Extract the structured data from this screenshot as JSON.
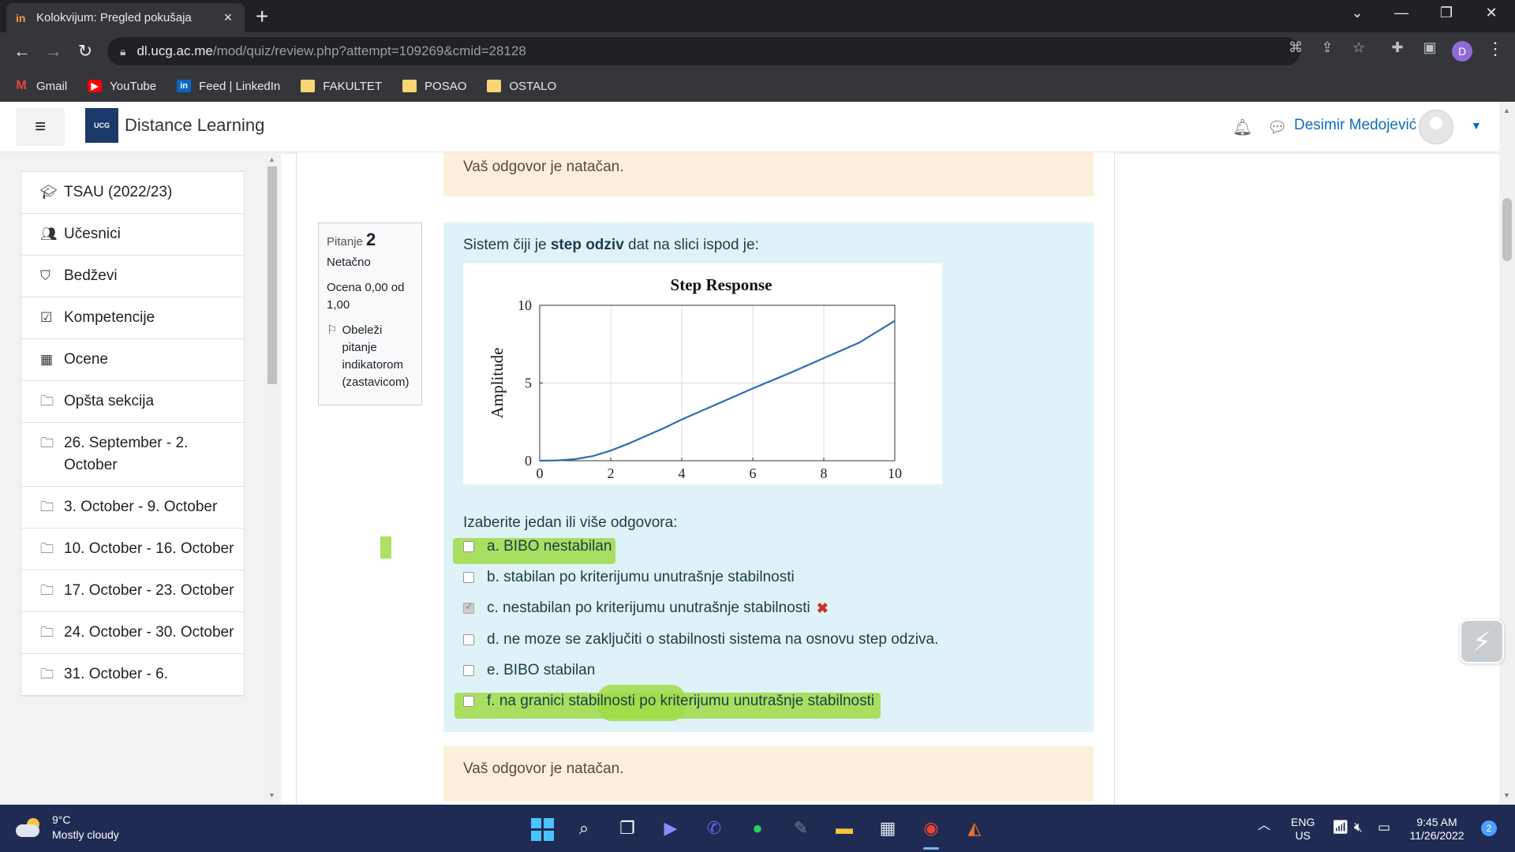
{
  "browser": {
    "tab_title": "Kolokvijum: Pregled pokušaja",
    "favicon": "in",
    "url_host": "dl.ucg.ac.me",
    "url_path": "/mod/quiz/review.php?attempt=109269&cmid=28128",
    "profile_initial": "D",
    "bookmarks": [
      {
        "label": "Gmail",
        "icon": "gmail-icon"
      },
      {
        "label": "YouTube",
        "icon": "youtube-icon"
      },
      {
        "label": "Feed | LinkedIn",
        "icon": "linkedin-icon"
      },
      {
        "label": "FAKULTET",
        "icon": "folder-icon"
      },
      {
        "label": "POSAO",
        "icon": "folder-icon"
      },
      {
        "label": "OSTALO",
        "icon": "folder-icon"
      }
    ]
  },
  "header": {
    "logo_text": "UCG",
    "site_name": "Distance Learning",
    "user_name": "Desimir Medojević"
  },
  "sidebar": {
    "items": [
      {
        "label": "TSAU (2022/23)",
        "icon": "graduation-cap-icon"
      },
      {
        "label": "Učesnici",
        "icon": "users-icon"
      },
      {
        "label": "Bedževi",
        "icon": "shield-icon"
      },
      {
        "label": "Kompetencije",
        "icon": "checkbox-icon"
      },
      {
        "label": "Ocene",
        "icon": "table-icon"
      },
      {
        "label": "Opšta sekcija",
        "icon": "folder-icon"
      },
      {
        "label": "26. September - 2. October",
        "icon": "folder-icon"
      },
      {
        "label": "3. October - 9. October",
        "icon": "folder-icon"
      },
      {
        "label": "10. October - 16. October",
        "icon": "folder-icon"
      },
      {
        "label": "17. October - 23. October",
        "icon": "folder-icon"
      },
      {
        "label": "24. October - 30. October",
        "icon": "folder-icon"
      },
      {
        "label": "31. October - 6.",
        "icon": "folder-icon"
      }
    ]
  },
  "quiz": {
    "feedback_top": "Vaš odgovor je natačan.",
    "feedback_bottom": "Vaš odgovor je natačan.",
    "info": {
      "question_label": "Pitanje",
      "question_number": "2",
      "state": "Netačno",
      "grade": "Ocena 0,00 od 1,00",
      "flag_label": "Obeleži pitanje indikatorom (zastavicom)"
    },
    "question_pre": "Sistem čiji je ",
    "question_bold": "step odziv",
    "question_post": " dat na slici ispod je:",
    "prompt": "Izaberite jedan ili više odgovora:",
    "answers": [
      {
        "text": "a. BIBO nestabilan",
        "checked": false,
        "wrong": false,
        "highlighted": true
      },
      {
        "text": "b. stabilan po kriterijumu unutrašnje stabilnosti",
        "checked": false,
        "wrong": false,
        "highlighted": false
      },
      {
        "text": "c. nestabilan po kriterijumu unutrašnje stabilnosti",
        "checked": true,
        "wrong": true,
        "highlighted": false
      },
      {
        "text": "d. ne moze se zaključiti o stabilnosti sistema na osnovu step odziva.",
        "checked": false,
        "wrong": false,
        "highlighted": false
      },
      {
        "text": "e. BIBO stabilan",
        "checked": false,
        "wrong": false,
        "highlighted": false
      },
      {
        "text": "f. na granici stabilnosti po kriterijumu unutrašnje stabilnosti",
        "checked": false,
        "wrong": false,
        "highlighted": true
      }
    ],
    "wrong_mark": "✖"
  },
  "chart_data": {
    "type": "line",
    "title": "Step Response",
    "xlabel": "",
    "ylabel": "Amplitude",
    "xlim": [
      0,
      10
    ],
    "ylim": [
      0,
      10
    ],
    "xticks": [
      0,
      2,
      4,
      6,
      8,
      10
    ],
    "yticks": [
      0,
      5,
      10
    ],
    "grid": true,
    "series": [
      {
        "color": "#2f6db5",
        "x": [
          0,
          0.5,
          1,
          1.5,
          2,
          2.5,
          3,
          3.5,
          4,
          5,
          6,
          7,
          8,
          9,
          10
        ],
        "y": [
          0,
          0.02,
          0.1,
          0.3,
          0.65,
          1.1,
          1.6,
          2.1,
          2.65,
          3.65,
          4.65,
          5.6,
          6.6,
          7.6,
          9.0
        ]
      }
    ]
  },
  "taskbar": {
    "temperature": "9°C",
    "weather": "Mostly cloudy",
    "lang": "ENG",
    "region": "US",
    "time": "9:45 AM",
    "date": "11/26/2022",
    "notifications": "2"
  }
}
